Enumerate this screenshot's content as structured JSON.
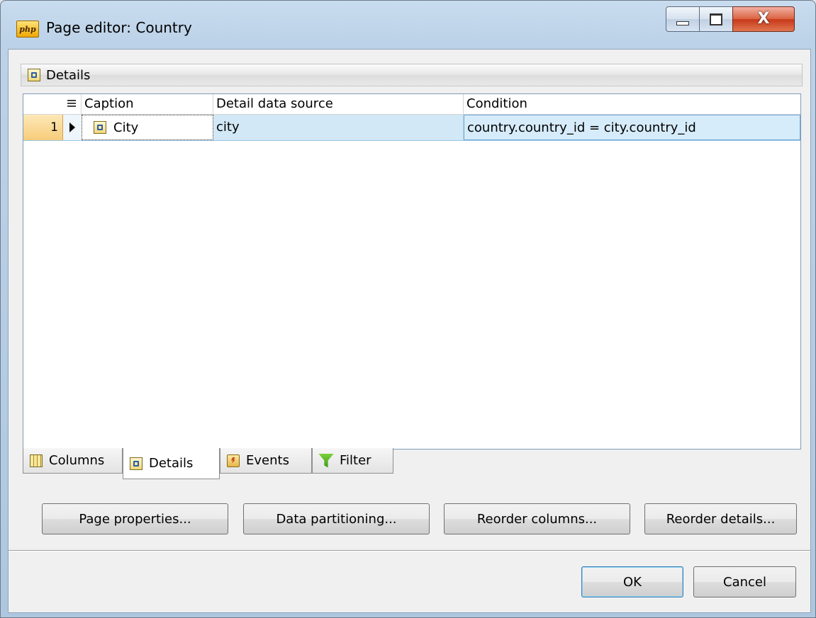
{
  "window": {
    "app_icon_text": "php",
    "title": "Page editor: Country",
    "close_glyph": "X"
  },
  "details_bar": {
    "label": "Details"
  },
  "grid": {
    "columns": [
      "Caption",
      "Detail data source",
      "Condition"
    ],
    "rows": [
      {
        "number": "1",
        "caption": "City",
        "detail_data_source": "city",
        "condition": "country.country_id = city.country_id"
      }
    ]
  },
  "tabs": [
    {
      "label": "Columns",
      "icon": "columns-grid-icon"
    },
    {
      "label": "Details",
      "icon": "details-icon",
      "selected": true
    },
    {
      "label": "Events",
      "icon": "events-icon"
    },
    {
      "label": "Filter",
      "icon": "filter-funnel-icon"
    }
  ],
  "actions": {
    "page_properties": "Page properties...",
    "data_partitioning": "Data partitioning...",
    "reorder_columns": "Reorder columns...",
    "reorder_details": "Reorder details..."
  },
  "dialog_buttons": {
    "ok": "OK",
    "cancel": "Cancel"
  },
  "colors": {
    "selected_row": "#d2e8f6",
    "row_number_bg": "#f7cc7a",
    "ok_border": "#3c7fb1",
    "close_button": "#c7381a"
  }
}
